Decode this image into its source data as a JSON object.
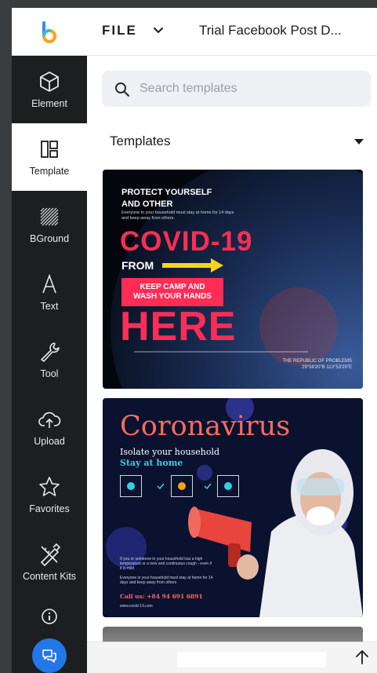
{
  "header": {
    "file_label": "FILE",
    "doc_title": "Trial Facebook Post D...",
    "logo_icon": "app-logo",
    "chevron_icon": "chevron-down-icon"
  },
  "sidebar": {
    "items": [
      {
        "label": "Element",
        "icon": "cube-icon",
        "active": false
      },
      {
        "label": "Template",
        "icon": "template-layout-icon",
        "active": true
      },
      {
        "label": "BGround",
        "icon": "background-stripes-icon",
        "active": false
      },
      {
        "label": "Text",
        "icon": "text-a-icon",
        "active": false
      },
      {
        "label": "Tool",
        "icon": "wrench-icon",
        "active": false
      },
      {
        "label": "Upload",
        "icon": "cloud-upload-icon",
        "active": false
      },
      {
        "label": "Favorites",
        "icon": "star-icon",
        "active": false
      },
      {
        "label": "Content Kits",
        "icon": "pen-ruler-icon",
        "active": false
      }
    ],
    "info_icon": "info-icon",
    "chat_icon": "chat-bubbles-icon",
    "chat_color": "#2377e6"
  },
  "search": {
    "placeholder": "Search templates",
    "value": ""
  },
  "templates": {
    "heading": "Templates",
    "cards": [
      {
        "name": "covid-19-poster",
        "line1": "PROTECT YOURSELF",
        "line2": "AND OTHER",
        "small": "Everyone in your household must stay at home for 14 days and keep away from others.",
        "big": "COVID-19",
        "from": "FROM",
        "keep1": "KEEP CAMP AND",
        "keep2": "WASH YOUR HANDS",
        "here": "HERE",
        "republic": "THE REPUBLIC OF PROBLEMS",
        "coords": "29°58'20\"B 113°53'29\"E"
      },
      {
        "name": "coronavirus-poster",
        "title": "Coronavirus",
        "isolate": "Isolate your household",
        "stay": "Stay at home",
        "bullet1": "If you or someone in your household has a high temperature or a new and continuous cough - even if it is mild",
        "bullet2": "Everyone in your household must stay at home for 14 days and keep away from others",
        "call": "Call us: +84 94 691 6891",
        "site": "www.covid-19.com"
      }
    ]
  },
  "footer": {
    "scroll_top_icon": "arrow-up-icon"
  },
  "colors": {
    "sidebar_bg": "#1d1e20",
    "accent_red": "#ff2d55",
    "accent_coral": "#ff6a5c",
    "accent_cyan": "#33d1e0"
  }
}
